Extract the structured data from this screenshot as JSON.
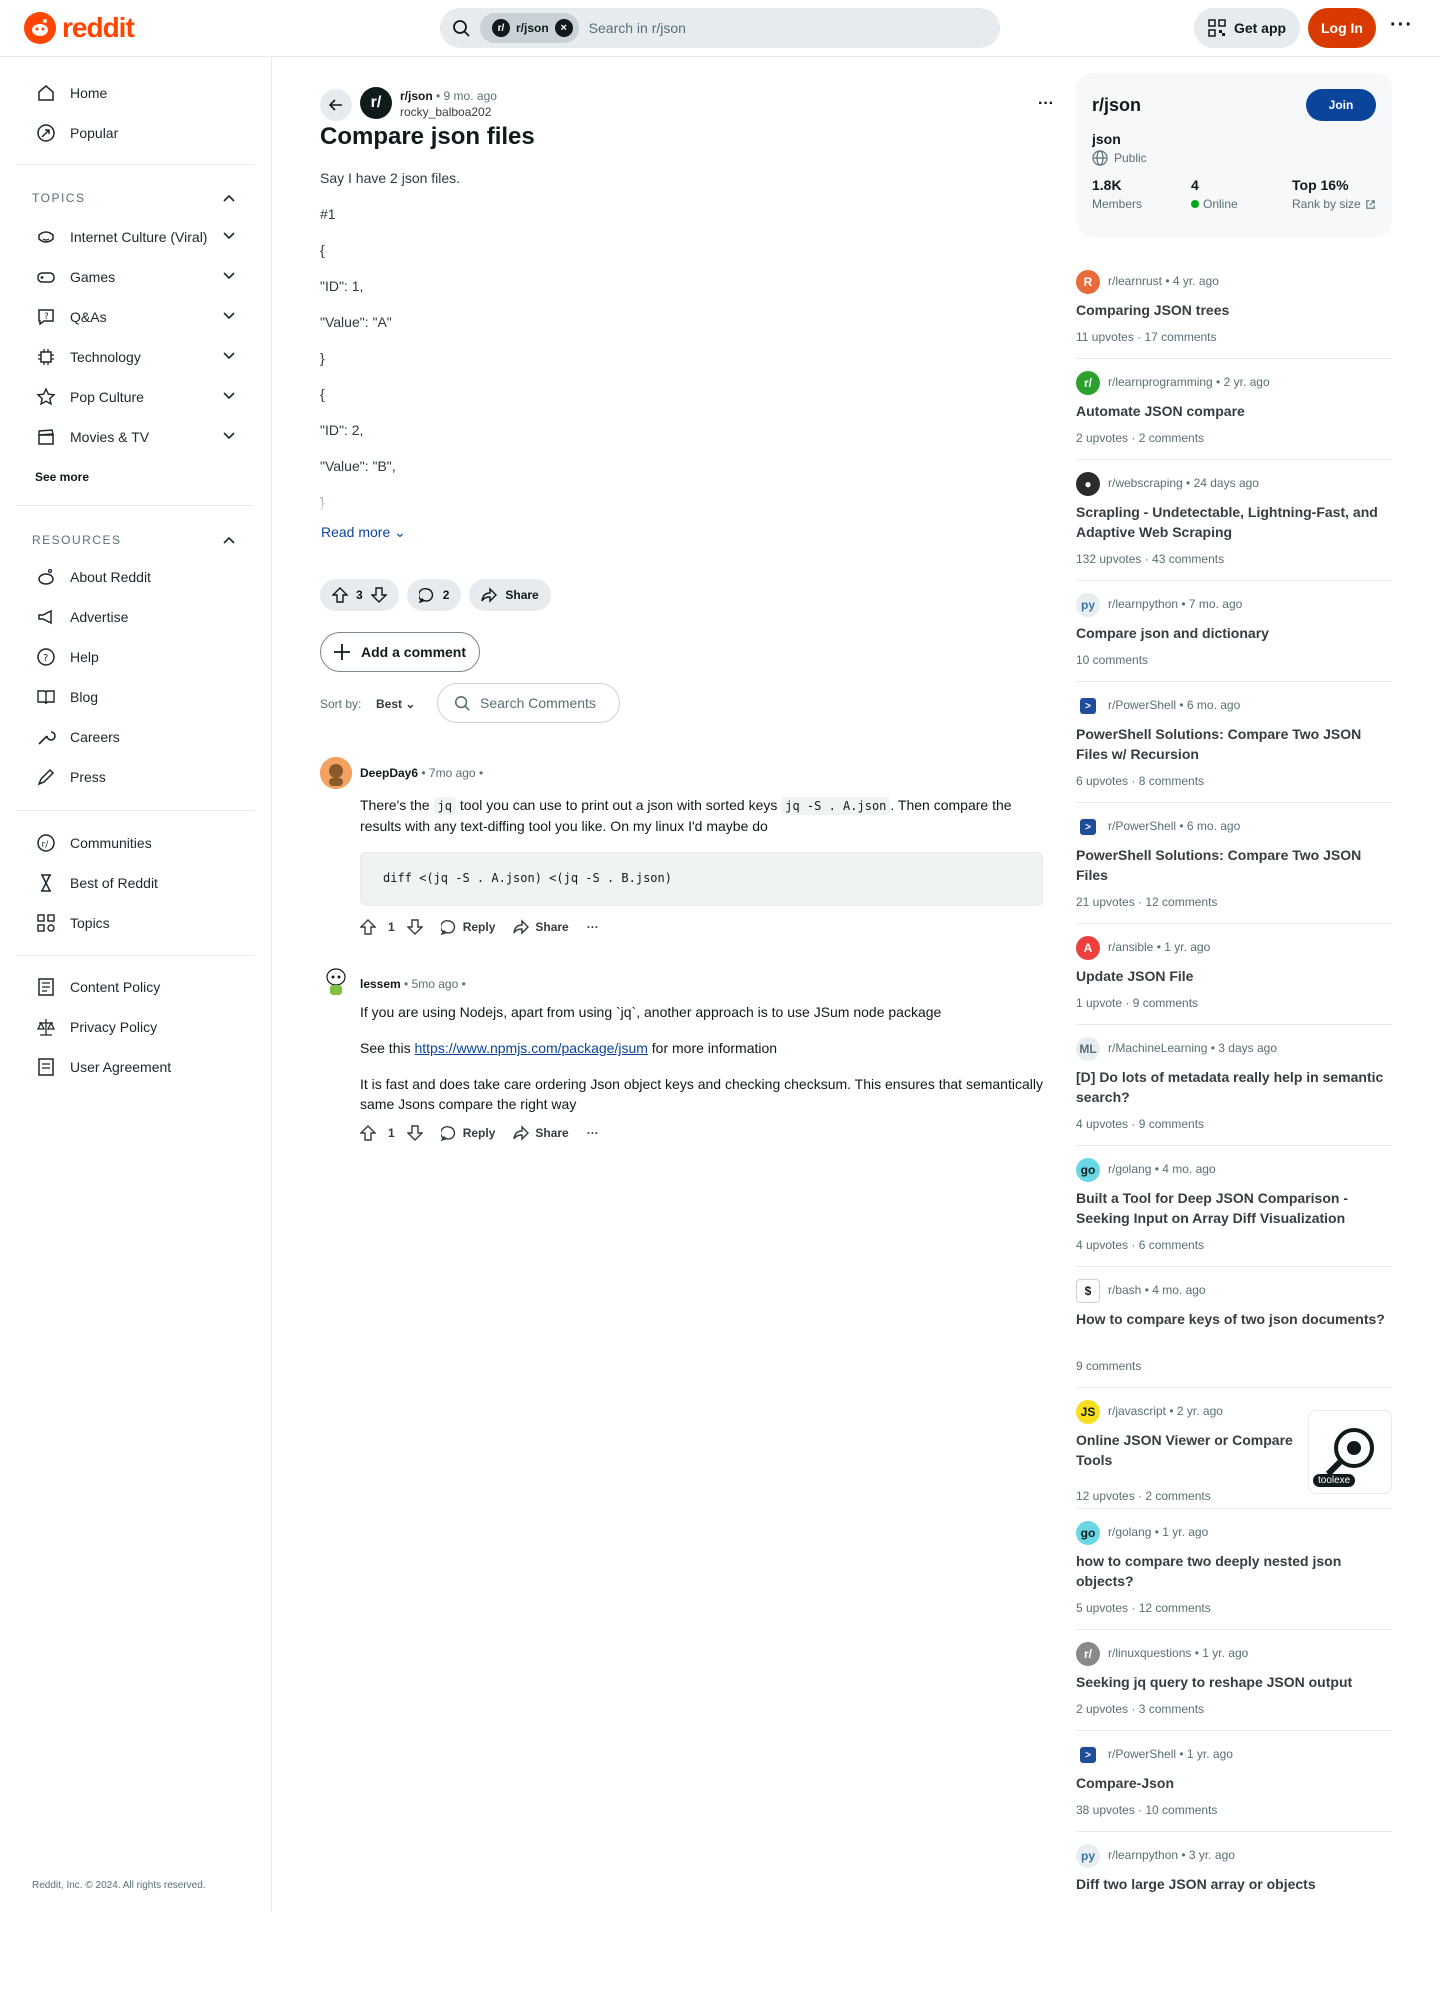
{
  "header": {
    "logo_text": "reddit",
    "pill_label": "r/json",
    "search_placeholder": "Search in r/json",
    "get_app": "Get app",
    "login": "Log In"
  },
  "sidebar": {
    "home": "Home",
    "popular": "Popular",
    "topics_title": "TOPICS",
    "topics": [
      "Internet Culture (Viral)",
      "Games",
      "Q&As",
      "Technology",
      "Pop Culture",
      "Movies & TV"
    ],
    "see_more": "See more",
    "resources_title": "RESOURCES",
    "resources": [
      "About Reddit",
      "Advertise",
      "Help",
      "Blog",
      "Careers",
      "Press"
    ],
    "extra": [
      "Communities",
      "Best of Reddit",
      "Topics"
    ],
    "policies": [
      "Content Policy",
      "Privacy Policy",
      "User Agreement"
    ],
    "copyright": "Reddit, Inc. © 2024. All rights reserved."
  },
  "post": {
    "subreddit": "r/json",
    "age": "9 mo. ago",
    "author": "rocky_balboa202",
    "title": "Compare json files",
    "body": [
      "Say I have 2 json files.",
      "#1",
      "{",
      "\"ID\": 1,",
      "\"Value\": \"A\"",
      "}",
      "{",
      "\"ID\": 2,",
      "\"Value\": \"B\",",
      "}"
    ],
    "read_more": "Read more",
    "votes": "3",
    "comments": "2",
    "share": "Share",
    "add_comment": "Add a comment",
    "sort_label": "Sort by:",
    "sort_value": "Best",
    "search_comments": "Search Comments"
  },
  "comments": [
    {
      "author": "DeepDay6",
      "age": "7mo ago",
      "t1a": "There's the ",
      "code1": "jq",
      "t1b": " tool you can use to print out a json with sorted keys ",
      "code2": "jq -S . A.json",
      "t1c": ". Then compare the results with any text-diffing tool you like. On my linux I'd maybe do",
      "pre": "diff <(jq -S . A.json) <(jq -S . B.json)",
      "votes": "1",
      "reply": "Reply",
      "share": "Share"
    },
    {
      "author": "lessem",
      "age": "5mo ago",
      "p1": "If you are using Nodejs, apart from using `jq`, another approach is to use JSum node package",
      "p2a": "See this ",
      "link": "https://www.npmjs.com/package/jsum",
      "p2b": " for more information",
      "p3": "It is fast and does take care ordering Json object keys and checking checksum. This ensures that semantically same Jsons compare the right way",
      "votes": "1",
      "reply": "Reply",
      "share": "Share"
    }
  ],
  "community": {
    "name": "r/json",
    "join": "Join",
    "desc": "json",
    "visibility": "Public",
    "members": "1.8K",
    "members_label": "Members",
    "online": "4",
    "online_label": "Online",
    "rank": "Top 16%",
    "rank_label": "Rank by size"
  },
  "related": [
    {
      "sub": "r/learnrust",
      "age": "4 yr. ago",
      "title": "Comparing JSON trees",
      "stats": "11 upvotes · 17 comments"
    },
    {
      "sub": "r/learnprogramming",
      "age": "2 yr. ago",
      "title": "Automate JSON compare",
      "stats": "2 upvotes · 2 comments"
    },
    {
      "sub": "r/webscraping",
      "age": "24 days ago",
      "title": "Scrapling - Undetectable, Lightning-Fast, and Adaptive Web Scraping",
      "stats": "132 upvotes · 43 comments"
    },
    {
      "sub": "r/learnpython",
      "age": "7 mo. ago",
      "title": "Compare json and dictionary",
      "stats": "10 comments"
    },
    {
      "sub": "r/PowerShell",
      "age": "6 mo. ago",
      "title": "PowerShell Solutions: Compare Two JSON Files w/ Recursion",
      "stats": "6 upvotes · 8 comments"
    },
    {
      "sub": "r/PowerShell",
      "age": "6 mo. ago",
      "title": "PowerShell Solutions: Compare Two JSON Files",
      "stats": "21 upvotes · 12 comments"
    },
    {
      "sub": "r/ansible",
      "age": "1 yr. ago",
      "title": "Update JSON File",
      "stats": "1 upvote · 9 comments"
    },
    {
      "sub": "r/MachineLearning",
      "age": "3 days ago",
      "title": "[D] Do lots of metadata really help in semantic search?",
      "stats": "4 upvotes · 9 comments"
    },
    {
      "sub": "r/golang",
      "age": "4 mo. ago",
      "title": "Built a Tool for Deep JSON Comparison - Seeking Input on Array Diff Visualization",
      "stats": "4 upvotes · 6 comments"
    },
    {
      "sub": "r/bash",
      "age": "4 mo. ago",
      "title": "How to compare keys of two json documents?",
      "stats": "9 comments"
    },
    {
      "sub": "r/javascript",
      "age": "2 yr. ago",
      "title": "Online JSON Viewer or Compare Tools",
      "stats": "12 upvotes · 2 comments",
      "thumb": "toolexe"
    },
    {
      "sub": "r/golang",
      "age": "1 yr. ago",
      "title": "how to compare two deeply nested json objects?",
      "stats": "5 upvotes · 12 comments"
    },
    {
      "sub": "r/linuxquestions",
      "age": "1 yr. ago",
      "title": "Seeking jq query to reshape JSON output",
      "stats": "2 upvotes · 3 comments"
    },
    {
      "sub": "r/PowerShell",
      "age": "1 yr. ago",
      "title": "Compare-Json",
      "stats": "38 upvotes · 10 comments"
    },
    {
      "sub": "r/learnpython",
      "age": "3 yr. ago",
      "title": "Diff two large JSON array or objects",
      "stats": ""
    }
  ],
  "colors": {
    "brand": "#ff4500",
    "login": "#d93a00",
    "join": "#0a449b",
    "online": "#01a816"
  }
}
